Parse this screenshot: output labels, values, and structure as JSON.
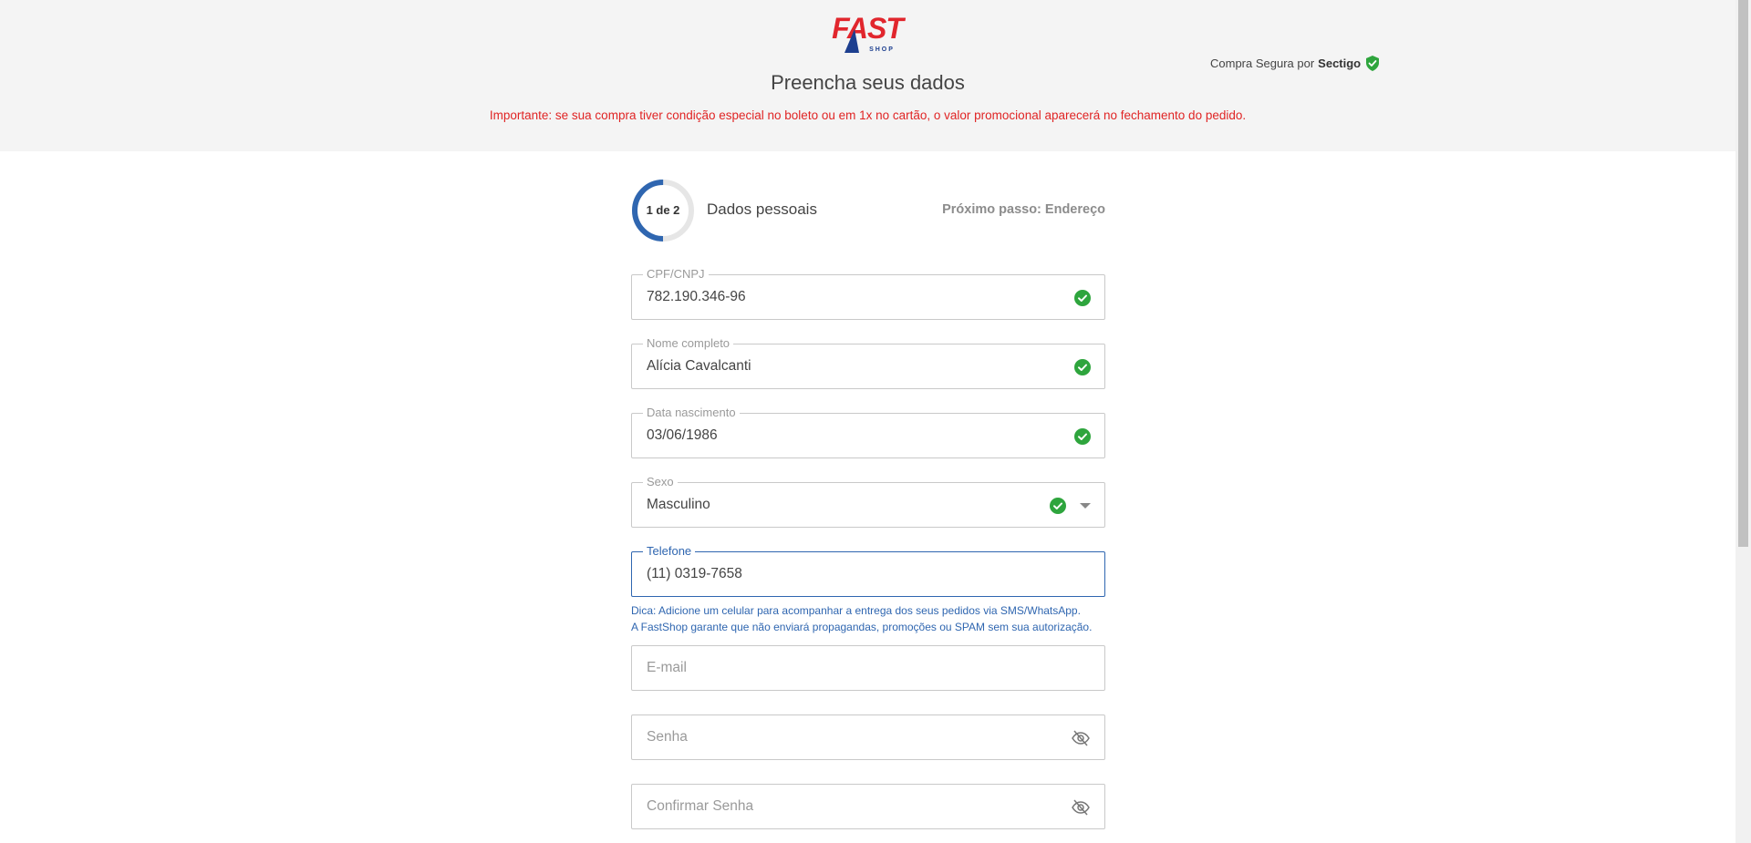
{
  "header": {
    "logo": {
      "word": "FAST",
      "sub": "SHOP",
      "color": "#e1262d",
      "accent": "#1d3f8f"
    },
    "secure": {
      "prefix": "Compra Segura por",
      "brand": "Sectigo",
      "icon": "shield-check-icon",
      "color": "#2ea53d"
    },
    "title": "Preencha seus dados",
    "notice": "Importante: se sua compra tiver condição especial no boleto ou em 1x no cartão, o valor promocional aparecerá no fechamento do pedido."
  },
  "stepper": {
    "progress_label": "1 de 2",
    "progress_fraction": 0.5,
    "current_step": "Dados pessoais",
    "next_step": "Próximo passo: Endereço",
    "accent": "#2f66b0"
  },
  "form": {
    "cpf": {
      "label": "CPF/CNPJ",
      "value": "782.190.346-96",
      "valid": true
    },
    "name": {
      "label": "Nome completo",
      "value": "Alícia Cavalcanti",
      "valid": true
    },
    "birth": {
      "label": "Data nascimento",
      "value": "03/06/1986",
      "valid": true
    },
    "sex": {
      "label": "Sexo",
      "value": "Masculino",
      "valid": true
    },
    "phone": {
      "label": "Telefone",
      "value": "(11) 0319-7658",
      "focused": true
    },
    "phone_hint": [
      "Dica: Adicione um celular para acompanhar a entrega dos seus pedidos via SMS/WhatsApp.",
      "A FastShop garante que não enviará propagandas, promoções ou SPAM sem sua autorização."
    ],
    "email": {
      "placeholder": "E-mail"
    },
    "password": {
      "placeholder": "Senha",
      "icon": "eye-off-icon"
    },
    "confirm_password": {
      "placeholder": "Confirmar Senha",
      "icon": "eye-off-icon"
    }
  },
  "colors": {
    "valid": "#2ea53d",
    "error": "#e02424",
    "focus": "#2f66b0"
  }
}
